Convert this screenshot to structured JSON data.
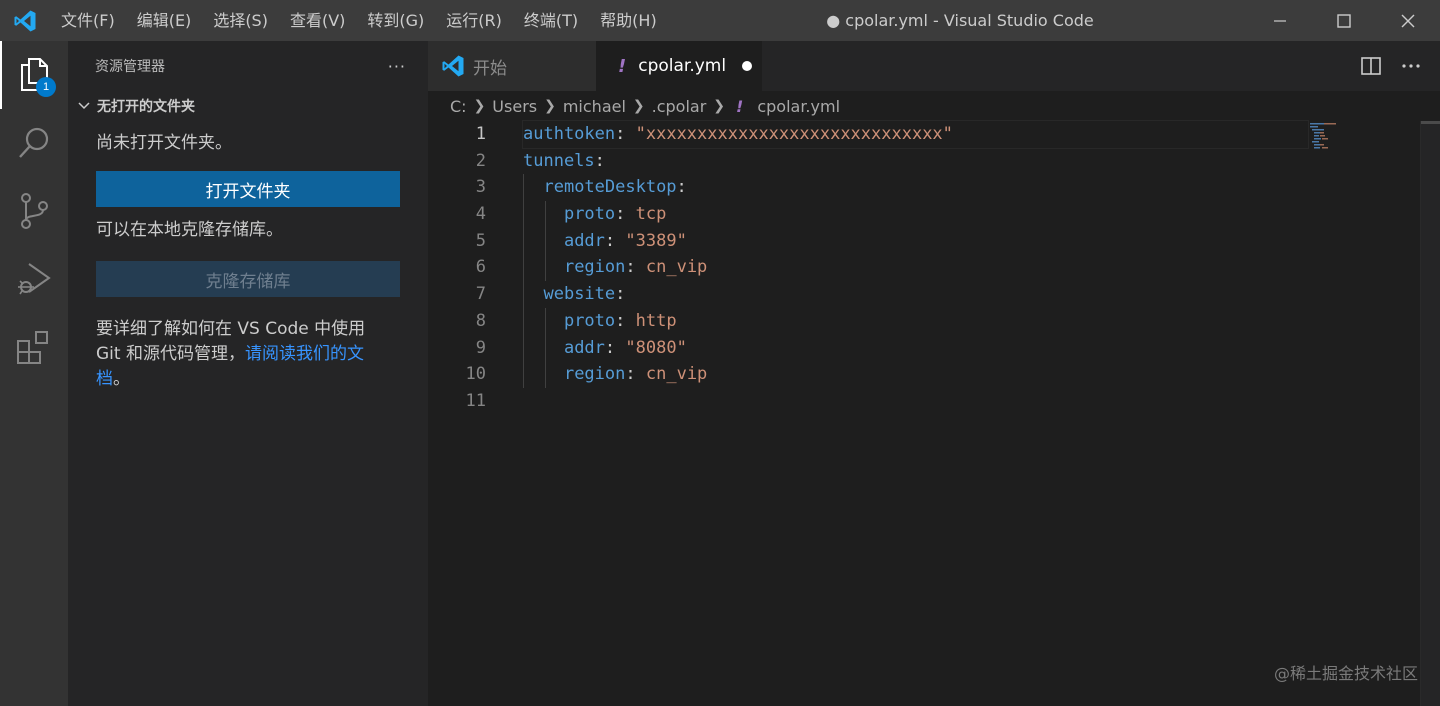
{
  "titlebar": {
    "menu": [
      "文件(F)",
      "编辑(E)",
      "选择(S)",
      "查看(V)",
      "转到(G)",
      "运行(R)",
      "终端(T)",
      "帮助(H)"
    ],
    "window_title": "● cpolar.yml - Visual Studio Code"
  },
  "activity_bar": {
    "explorer_badge": "1",
    "items": [
      "files-icon",
      "search-icon",
      "source-control-icon",
      "run-debug-icon",
      "extensions-icon"
    ]
  },
  "sidebar": {
    "title": "资源管理器",
    "more": "···",
    "section_title": "无打开的文件夹",
    "no_folder_text": "尚未打开文件夹。",
    "open_folder_button": "打开文件夹",
    "clone_hint": "可以在本地克隆存储库。",
    "clone_button": "克隆存储库",
    "learn_line1": "要详细了解如何在 VS Code 中使用",
    "learn_line2_prefix": "Git 和源代码管理，",
    "learn_link_part1": "请阅读我们的文",
    "learn_link_part2": "档",
    "learn_suffix": "。"
  },
  "tabs": [
    {
      "label": "开始",
      "active": false
    },
    {
      "label": "cpolar.yml",
      "active": true,
      "dirty": true
    }
  ],
  "breadcrumb": [
    "C:",
    "Users",
    "michael",
    ".cpolar",
    "cpolar.yml"
  ],
  "editor": {
    "current_line": 1,
    "lines": [
      {
        "n": "1",
        "key": "authtoken",
        "value": "\"xxxxxxxxxxxxxxxxxxxxxxxxxxxxx\""
      },
      {
        "n": "2",
        "key": "tunnels",
        "value": ""
      },
      {
        "n": "3",
        "key": "remoteDesktop",
        "value": ""
      },
      {
        "n": "4",
        "key": "proto",
        "value": "tcp"
      },
      {
        "n": "5",
        "key": "addr",
        "value": "\"3389\""
      },
      {
        "n": "6",
        "key": "region",
        "value": "cn_vip"
      },
      {
        "n": "7",
        "key": "website",
        "value": ""
      },
      {
        "n": "8",
        "key": "proto",
        "value": "http"
      },
      {
        "n": "9",
        "key": "addr",
        "value": "\"8080\""
      },
      {
        "n": "10",
        "key": "region",
        "value": "cn_vip"
      },
      {
        "n": "11",
        "key": "",
        "value": ""
      }
    ]
  },
  "watermark": "@稀土掘金技术社区",
  "colors": {
    "accent": "#007acc",
    "primary_button": "#0e639c",
    "yaml_key": "#569cd6",
    "yaml_value": "#ce9178",
    "link": "#3794ff"
  }
}
